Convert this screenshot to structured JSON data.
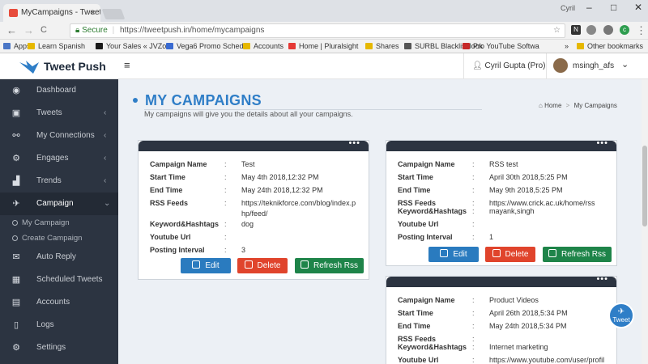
{
  "browser": {
    "tab_title": "MyCampaigns - Tweet Pu",
    "tab_close": "×",
    "profile": "Cyril",
    "window_controls": [
      "–",
      "□",
      "✕"
    ],
    "nav": [
      "←",
      "→",
      "C"
    ],
    "secure_label": "Secure",
    "url": "https://tweetpush.in/home/mycampaigns",
    "bookmarks": [
      {
        "label": "Apps",
        "color": "#4a76c6"
      },
      {
        "label": "Learn Spanish",
        "color": "#e6b800"
      },
      {
        "label": "Your Sales « JVZoo",
        "color": "#1b1b1b"
      },
      {
        "label": "Vega6 Promo Sched",
        "color": "#3a6bd1"
      },
      {
        "label": "Accounts",
        "color": "#e6b800"
      },
      {
        "label": "Home | Pluralsight",
        "color": "#e53935"
      },
      {
        "label": "Shares",
        "color": "#e6b800"
      },
      {
        "label": "SURBL Blacklist look",
        "color": "#555555"
      },
      {
        "label": "Pro YouTube Softwa",
        "color": "#c62828"
      },
      {
        "label": "»",
        "color": ""
      },
      {
        "label": "Other bookmarks",
        "color": "#e6b800"
      }
    ]
  },
  "app": {
    "logo_text": "Tweet Push",
    "menu_icon": "≡",
    "user_pro": "Cyril Gupta (Pro)",
    "user_account": "msingh_afs"
  },
  "sidebar": {
    "items": [
      {
        "label": "Dashboard",
        "icon": "dashboard-icon",
        "glyph": "◉",
        "chevron": ""
      },
      {
        "label": "Tweets",
        "icon": "tweets-icon",
        "glyph": "▣",
        "chevron": "‹"
      },
      {
        "label": "My Connections",
        "icon": "connections-icon",
        "glyph": "⚯",
        "chevron": "‹"
      },
      {
        "label": "Engages",
        "icon": "engages-icon",
        "glyph": "⚙",
        "chevron": "‹"
      },
      {
        "label": "Trends",
        "icon": "trends-icon",
        "glyph": "▟",
        "chevron": "‹"
      },
      {
        "label": "Campaign",
        "icon": "campaign-icon",
        "glyph": "✈",
        "chevron": "⌄"
      },
      {
        "label": "Auto Reply",
        "icon": "auto-reply-icon",
        "glyph": "✉",
        "chevron": ""
      },
      {
        "label": "Scheduled Tweets",
        "icon": "calendar-icon",
        "glyph": "▦",
        "chevron": ""
      },
      {
        "label": "Accounts",
        "icon": "accounts-icon",
        "glyph": "▤",
        "chevron": ""
      },
      {
        "label": "Logs",
        "icon": "logs-icon",
        "glyph": "▯",
        "chevron": ""
      },
      {
        "label": "Settings",
        "icon": "settings-icon",
        "glyph": "⚙",
        "chevron": ""
      }
    ],
    "subitems": [
      "My Campaign",
      "Create Campaign"
    ]
  },
  "page": {
    "title": "MY CAMPAIGNS",
    "subtitle": "My campaigns will give you the details about all your campaigns.",
    "breadcrumb_home": "Home",
    "breadcrumb_sep": ">",
    "breadcrumb_current": "My Campaigns"
  },
  "field_labels": [
    "Campaign Name",
    "Start Time",
    "End Time",
    "RSS Feeds",
    "Keyword&Hashtags",
    "Youtube Url",
    "Posting Interval"
  ],
  "separator": ":",
  "menu_dots": "•••",
  "buttons": {
    "edit": "Edit",
    "delete": "Delete",
    "refresh": "Refresh Rss"
  },
  "fab_label": "Tweet",
  "cards": [
    {
      "name": "Test",
      "start": "May 4th 2018,12:32 PM",
      "end": "May 24th 2018,12:32 PM",
      "rss": "https://teknikforce.com/blog/index.p",
      "rss2": "hp/feed/",
      "keywords": "dog",
      "youtube": "",
      "interval": "3"
    },
    {
      "name": "RSS test",
      "start": "April 30th 2018,5:25 PM",
      "end": "May 9th 2018,5:25 PM",
      "rss": "https://www.crick.ac.uk/home/rss",
      "rss2": "",
      "keywords": "mayank,singh",
      "youtube": "",
      "interval": "1"
    },
    {
      "name": "Product Videos",
      "start": "April 26th 2018,5:34 PM",
      "end": "May 24th 2018,5:34 PM",
      "rss": "",
      "rss2": "",
      "keywords": "Internet marketing",
      "youtube": "https://www.youtube.com/user/profil",
      "interval": ""
    }
  ]
}
